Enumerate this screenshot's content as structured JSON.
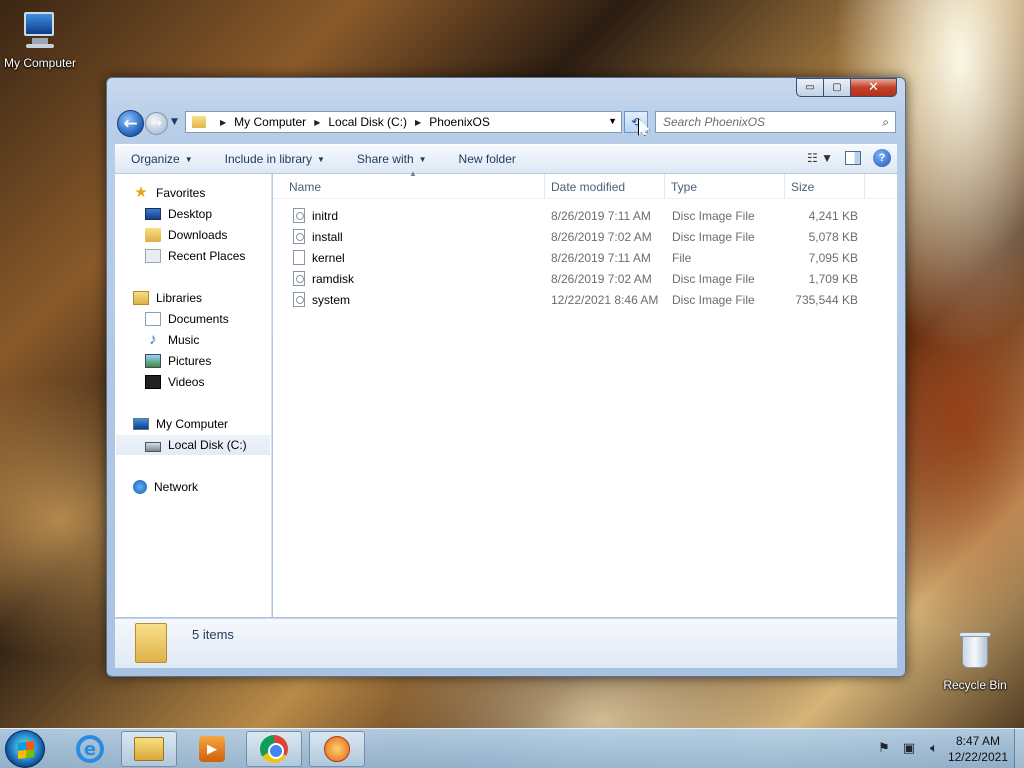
{
  "desktop": {
    "icons": [
      {
        "label": "My Computer",
        "icon": "my-computer-icon"
      },
      {
        "label": "Recycle Bin",
        "icon": "recycle-bin-icon"
      }
    ]
  },
  "window": {
    "controls": {
      "minimize": "▭",
      "maximize": "▢",
      "close": "✕"
    },
    "breadcrumb": [
      "My Computer",
      "Local Disk (C:)",
      "PhoenixOS"
    ],
    "search_placeholder": "Search PhoenixOS",
    "toolbar": {
      "organize": "Organize",
      "include_in_library": "Include in library",
      "share_with": "Share with",
      "new_folder": "New folder"
    },
    "nav_pane": {
      "favorites": {
        "label": "Favorites",
        "items": [
          "Desktop",
          "Downloads",
          "Recent Places"
        ]
      },
      "libraries": {
        "label": "Libraries",
        "items": [
          "Documents",
          "Music",
          "Pictures",
          "Videos"
        ]
      },
      "computer": {
        "label": "My Computer",
        "items": [
          "Local Disk (C:)"
        ],
        "selected": "Local Disk (C:)"
      },
      "network": {
        "label": "Network"
      }
    },
    "columns": {
      "name": "Name",
      "date": "Date modified",
      "type": "Type",
      "size": "Size"
    },
    "files": [
      {
        "name": "initrd",
        "date": "8/26/2019 7:11 AM",
        "type": "Disc Image File",
        "size": "4,241 KB",
        "icon": "disc-image-file-icon"
      },
      {
        "name": "install",
        "date": "8/26/2019 7:02 AM",
        "type": "Disc Image File",
        "size": "5,078 KB",
        "icon": "disc-image-file-icon"
      },
      {
        "name": "kernel",
        "date": "8/26/2019 7:11 AM",
        "type": "File",
        "size": "7,095 KB",
        "icon": "file-icon"
      },
      {
        "name": "ramdisk",
        "date": "8/26/2019 7:02 AM",
        "type": "Disc Image File",
        "size": "1,709 KB",
        "icon": "disc-image-file-icon"
      },
      {
        "name": "system",
        "date": "12/22/2021 8:46 AM",
        "type": "Disc Image File",
        "size": "735,544 KB",
        "icon": "disc-image-file-icon"
      }
    ],
    "status": {
      "item_count": "5 items"
    }
  },
  "taskbar": {
    "pinned": [
      "internet-explorer-icon",
      "windows-explorer-icon",
      "media-player-icon",
      "chrome-icon",
      "phoenixos-installer-icon"
    ],
    "clock_time": "8:47 AM",
    "clock_date": "12/22/2021"
  }
}
